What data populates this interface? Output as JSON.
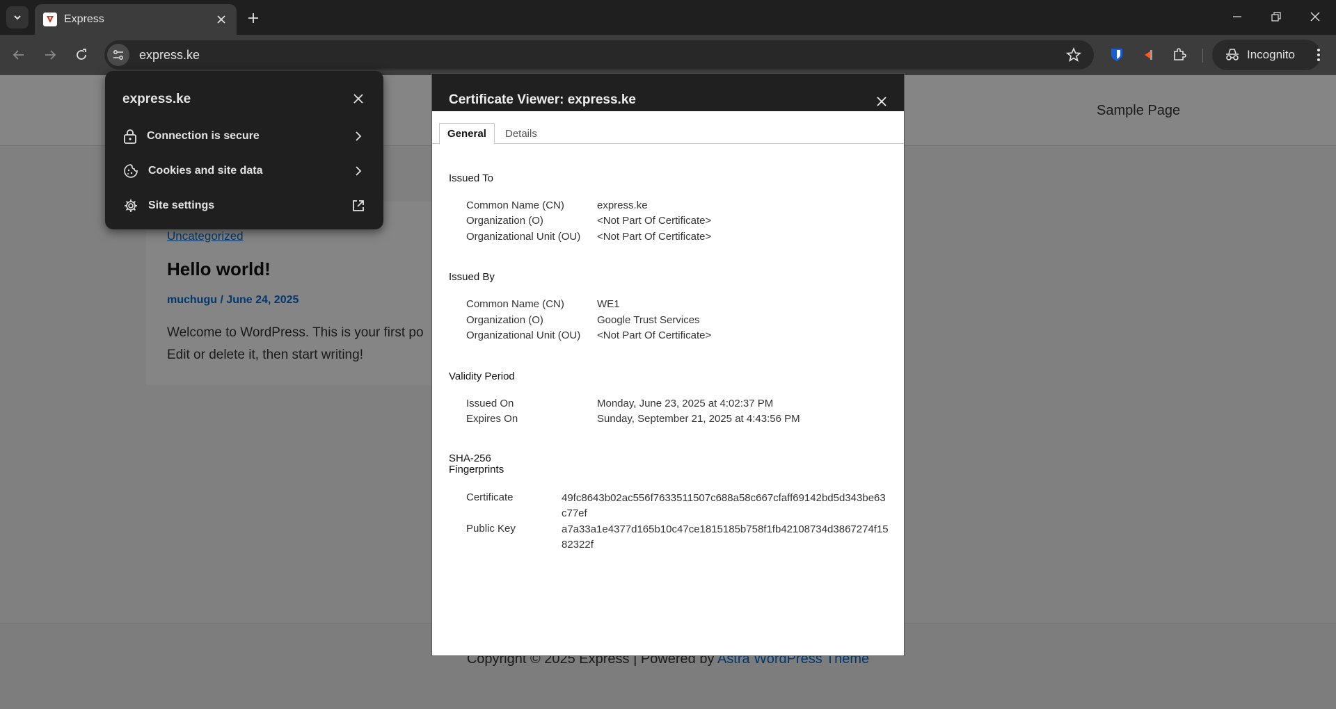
{
  "browser": {
    "tab": {
      "title": "Express"
    },
    "url": "express.ke",
    "incognito_label": "Incognito"
  },
  "site_popup": {
    "title": "express.ke",
    "items": [
      {
        "label": "Connection is secure",
        "icon": "lock-icon",
        "action": "chevron-right-icon"
      },
      {
        "label": "Cookies and site data",
        "icon": "cookie-icon",
        "action": "chevron-right-icon"
      },
      {
        "label": "Site settings",
        "icon": "gear-icon",
        "action": "external-link-icon"
      }
    ]
  },
  "page": {
    "nav_link": "Sample Page",
    "post": {
      "category": "Uncategorized",
      "title": "Hello world!",
      "meta": "muchugu / June 24, 2025",
      "excerpt_line1": "Welcome to WordPress. This is your first po",
      "excerpt_line2": "Edit or delete it, then start writing!"
    },
    "footer": {
      "text": "Copyright © 2025 Express | Powered by ",
      "link": "Astra WordPress Theme"
    }
  },
  "certificate": {
    "title": "Certificate Viewer: express.ke",
    "tabs": [
      "General",
      "Details"
    ],
    "issued_to": {
      "heading": "Issued To",
      "rows": [
        {
          "key": "Common Name (CN)",
          "value": "express.ke"
        },
        {
          "key": "Organization (O)",
          "value": "<Not Part Of Certificate>"
        },
        {
          "key": "Organizational Unit (OU)",
          "value": "<Not Part Of Certificate>"
        }
      ]
    },
    "issued_by": {
      "heading": "Issued By",
      "rows": [
        {
          "key": "Common Name (CN)",
          "value": "WE1"
        },
        {
          "key": "Organization (O)",
          "value": "Google Trust Services"
        },
        {
          "key": "Organizational Unit (OU)",
          "value": "<Not Part Of Certificate>"
        }
      ]
    },
    "validity": {
      "heading": "Validity Period",
      "rows": [
        {
          "key": "Issued On",
          "value": "Monday, June 23, 2025 at 4:02:37 PM"
        },
        {
          "key": "Expires On",
          "value": "Sunday, September 21, 2025 at 4:43:56 PM"
        }
      ]
    },
    "fingerprints": {
      "heading_line1": "SHA-256",
      "heading_line2": "Fingerprints",
      "rows": [
        {
          "key": "Certificate",
          "value": "49fc8643b02ac556f7633511507c688a58c667cfaff69142bd5d343be63c77ef"
        },
        {
          "key": "Public Key",
          "value": "a7a33a1e4377d165b10c47ce1815185b758f1fb42108734d3867274f1582322f"
        }
      ]
    }
  }
}
